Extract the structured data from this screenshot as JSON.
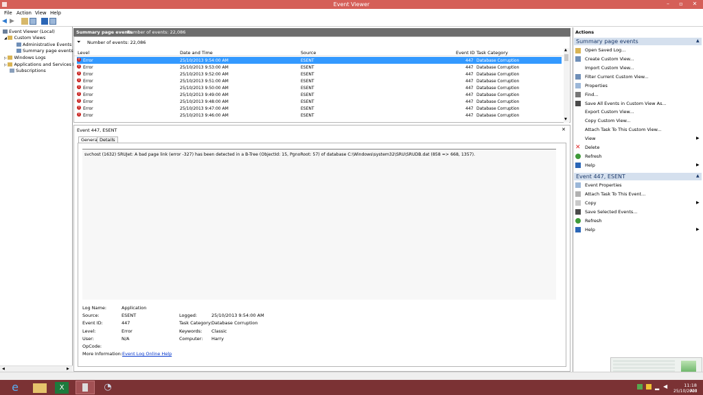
{
  "window": {
    "title": "Event Viewer",
    "minimize": "–",
    "maximize": "▫",
    "close": "✕"
  },
  "menu": {
    "items": [
      "File",
      "Action",
      "View",
      "Help"
    ]
  },
  "tree": {
    "root": "Event Viewer (Local)",
    "custom_views": "Custom Views",
    "admin_events": "Administrative Events",
    "summary": "Summary page events",
    "windows_logs": "Windows Logs",
    "apps_services": "Applications and Services Lo",
    "subscriptions": "Subscriptions"
  },
  "center": {
    "header_title": "Summary page events",
    "header_count": "Number of events: 22,086",
    "filter_count": "Number of events: 22,086",
    "columns": {
      "level": "Level",
      "date": "Date and Time",
      "source": "Source",
      "event_id": "Event ID",
      "category": "Task Category"
    },
    "rows": [
      {
        "level": "Error",
        "date": "25/10/2013 9:54:00 AM",
        "source": "ESENT",
        "event_id": "447",
        "category": "Database Corruption"
      },
      {
        "level": "Error",
        "date": "25/10/2013 9:53:00 AM",
        "source": "ESENT",
        "event_id": "447",
        "category": "Database Corruption"
      },
      {
        "level": "Error",
        "date": "25/10/2013 9:52:00 AM",
        "source": "ESENT",
        "event_id": "447",
        "category": "Database Corruption"
      },
      {
        "level": "Error",
        "date": "25/10/2013 9:51:00 AM",
        "source": "ESENT",
        "event_id": "447",
        "category": "Database Corruption"
      },
      {
        "level": "Error",
        "date": "25/10/2013 9:50:00 AM",
        "source": "ESENT",
        "event_id": "447",
        "category": "Database Corruption"
      },
      {
        "level": "Error",
        "date": "25/10/2013 9:49:00 AM",
        "source": "ESENT",
        "event_id": "447",
        "category": "Database Corruption"
      },
      {
        "level": "Error",
        "date": "25/10/2013 9:48:00 AM",
        "source": "ESENT",
        "event_id": "447",
        "category": "Database Corruption"
      },
      {
        "level": "Error",
        "date": "25/10/2013 9:47:00 AM",
        "source": "ESENT",
        "event_id": "447",
        "category": "Database Corruption"
      },
      {
        "level": "Error",
        "date": "25/10/2013 9:46:00 AM",
        "source": "ESENT",
        "event_id": "447",
        "category": "Database Corruption"
      }
    ]
  },
  "detail": {
    "title": "Event 447, ESENT",
    "close": "✕",
    "tabs": [
      "General",
      "Details"
    ],
    "message": "svchost (1632) SRUJet: A bad page link (error -327) has been detected in a B-Tree (ObjectId: 15, PgnoRoot: 57) of database C:\\Windows\\system32\\SRU\\SRUDB.dat (858 => 668, 1357).",
    "labels": {
      "log_name": "Log Name:",
      "source": "Source:",
      "event_id": "Event ID:",
      "level": "Level:",
      "user": "User:",
      "opcode": "OpCode:",
      "more_info": "More Information:",
      "logged": "Logged:",
      "task_category": "Task Category:",
      "keywords": "Keywords:",
      "computer": "Computer:"
    },
    "values": {
      "log_name": "Application",
      "source": "ESENT",
      "event_id": "447",
      "level": "Error",
      "user": "N/A",
      "logged": "25/10/2013 9:54:00 AM",
      "task_category": "Database Corruption",
      "keywords": "Classic",
      "computer": "Harry",
      "more_info_link": "Event Log Online Help"
    }
  },
  "actions": {
    "title": "Actions",
    "section1": "Summary page events",
    "items1": [
      "Open Saved Log...",
      "Create Custom View...",
      "Import Custom View...",
      "Filter Current Custom View...",
      "Properties",
      "Find...",
      "Save All Events in Custom View As...",
      "Export Custom View...",
      "Copy Custom View...",
      "Attach Task To This Custom View...",
      "View",
      "Delete",
      "Refresh",
      "Help"
    ],
    "section2": "Event 447, ESENT",
    "items2": [
      "Event Properties",
      "Attach Task To This Event...",
      "Copy",
      "Save Selected Events...",
      "Refresh",
      "Help"
    ]
  },
  "taskbar": {
    "time": "11:18 AM",
    "date": "25/10/2013"
  },
  "colors": {
    "titlebar": "#d55f58",
    "taskbar": "#7b3234",
    "selected_row": "#3399ff",
    "error": "#c9211e",
    "link": "#0033cc"
  }
}
